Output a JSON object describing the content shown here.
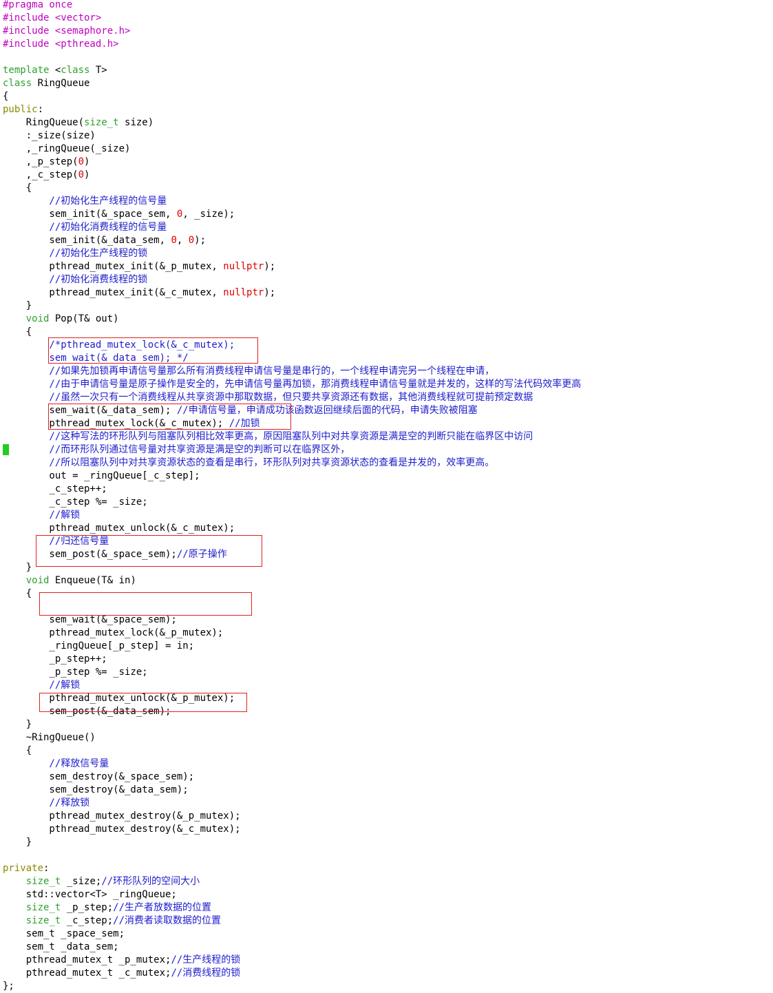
{
  "palette": {
    "default": "#000000",
    "preprocessor": "#c000c0",
    "keyword": "#8a8a00",
    "type": "#2ea02e",
    "number": "#dd0000",
    "comment": "#1c1ccc",
    "highlight_box": "#e0201c",
    "cursor": "#22cc22"
  },
  "lines": [
    [
      [
        "#pragma once",
        "preprocessor"
      ]
    ],
    [
      [
        "#include <vector>",
        "preprocessor"
      ]
    ],
    [
      [
        "#include <semaphore.h>",
        "preprocessor"
      ]
    ],
    [
      [
        "#include <pthread.h>",
        "preprocessor"
      ]
    ],
    [],
    [
      [
        "template",
        "type"
      ],
      [
        " <",
        ""
      ],
      [
        "class",
        "type"
      ],
      [
        " T>",
        ""
      ]
    ],
    [
      [
        "class",
        "type"
      ],
      [
        " RingQueue",
        ""
      ]
    ],
    [
      [
        "{",
        ""
      ]
    ],
    [
      [
        "public",
        "keyword"
      ],
      [
        ":",
        ""
      ]
    ],
    [
      [
        "    RingQueue(",
        ""
      ],
      [
        "size_t",
        "type"
      ],
      [
        " size)",
        ""
      ]
    ],
    [
      [
        "    :_size(size)",
        ""
      ]
    ],
    [
      [
        "    ,_ringQueue(_size)",
        ""
      ]
    ],
    [
      [
        "    ,_p_step(",
        ""
      ],
      [
        "0",
        "number"
      ],
      [
        ")",
        ""
      ]
    ],
    [
      [
        "    ,_c_step(",
        ""
      ],
      [
        "0",
        "number"
      ],
      [
        ")",
        ""
      ]
    ],
    [
      [
        "    {",
        ""
      ]
    ],
    [
      [
        "        //初始化生产线程的信号量",
        "comment"
      ]
    ],
    [
      [
        "        sem_init(&_space_sem, ",
        ""
      ],
      [
        "0",
        "number"
      ],
      [
        ", _size);",
        ""
      ]
    ],
    [
      [
        "        //初始化消费线程的信号量",
        "comment"
      ]
    ],
    [
      [
        "        sem_init(&_data_sem, ",
        ""
      ],
      [
        "0",
        "number"
      ],
      [
        ", ",
        ""
      ],
      [
        "0",
        "number"
      ],
      [
        ");",
        ""
      ]
    ],
    [
      [
        "        //初始化生产线程的锁",
        "comment"
      ]
    ],
    [
      [
        "        pthread_mutex_init(&_p_mutex, ",
        ""
      ],
      [
        "nullptr",
        "number"
      ],
      [
        ");",
        ""
      ]
    ],
    [
      [
        "        //初始化消费线程的锁",
        "comment"
      ]
    ],
    [
      [
        "        pthread_mutex_init(&_c_mutex, ",
        ""
      ],
      [
        "nullptr",
        "number"
      ],
      [
        ");",
        ""
      ]
    ],
    [
      [
        "    }",
        ""
      ]
    ],
    [
      [
        "    ",
        ""
      ],
      [
        "void",
        "type"
      ],
      [
        " Pop(T& out)",
        ""
      ]
    ],
    [
      [
        "    {",
        ""
      ]
    ],
    [
      [
        "        /*pthread_mutex_lock(&_c_mutex);",
        "comment"
      ]
    ],
    [
      [
        "        sem_wait(&_data_sem); */",
        "comment"
      ]
    ],
    [
      [
        "        //如果先加锁再申请信号量那么所有消费线程申请信号量是串行的，一个线程申请完另一个线程在申请，",
        "comment"
      ]
    ],
    [
      [
        "        //由于申请信号量是原子操作是安全的，先申请信号量再加锁，那消费线程申请信号量就是并发的，这样的写法代码效率更高",
        "comment"
      ]
    ],
    [
      [
        "        //虽然一次只有一个消费线程从共享资源中那取数据，但只要共享资源还有数据，其他消费线程就可提前预定数据",
        "comment"
      ]
    ],
    [
      [
        "        sem_wait(&_data_sem); ",
        ""
      ],
      [
        "//申请信号量，申请成功该函数返回继续后面的代码，申请失败被阻塞",
        "comment"
      ]
    ],
    [
      [
        "        pthread_mutex_lock(&_c_mutex); ",
        ""
      ],
      [
        "//加锁",
        "comment"
      ]
    ],
    [
      [
        "        //这种写法的环形队列与阻塞队列相比效率更高，原因阻塞队列中对共享资源是满是空的判断只能在临界区中访问",
        "comment"
      ]
    ],
    [
      [
        "        //而环形队列通过信号量对共享资源是满是空的判断可以在临界区外，",
        "comment"
      ]
    ],
    [
      [
        "        //所以阻塞队列中对共享资源状态的查看是串行，环形队列对共享资源状态的查看是并发的，效率更高。",
        "comment"
      ]
    ],
    [
      [
        "        out = _ringQueue[_c_step];",
        ""
      ]
    ],
    [
      [
        "        _c_step++;",
        ""
      ]
    ],
    [
      [
        "        _c_step %= _size;",
        ""
      ]
    ],
    [
      [
        "        //解锁",
        "comment"
      ]
    ],
    [
      [
        "        pthread_mutex_unlock(&_c_mutex);",
        ""
      ]
    ],
    [
      [
        "        //归还信号量",
        "comment"
      ]
    ],
    [
      [
        "        sem_post(&_space_sem);",
        ""
      ],
      [
        "//原子操作",
        "comment"
      ]
    ],
    [
      [
        "    }",
        ""
      ]
    ],
    [
      [
        "    ",
        ""
      ],
      [
        "void",
        "type"
      ],
      [
        " Enqueue(T& in)",
        ""
      ]
    ],
    [
      [
        "    {",
        ""
      ]
    ],
    [],
    [
      [
        "        sem_wait(&_space_sem);",
        ""
      ]
    ],
    [
      [
        "        pthread_mutex_lock(&_p_mutex);",
        ""
      ]
    ],
    [
      [
        "        _ringQueue[_p_step] = in;",
        ""
      ]
    ],
    [
      [
        "        _p_step++;",
        ""
      ]
    ],
    [
      [
        "        _p_step %= _size;",
        ""
      ]
    ],
    [
      [
        "        //解锁",
        "comment"
      ]
    ],
    [
      [
        "        pthread_mutex_unlock(&_p_mutex);",
        ""
      ]
    ],
    [
      [
        "        sem_post(&_data_sem);",
        ""
      ]
    ],
    [
      [
        "    }",
        ""
      ]
    ],
    [
      [
        "    ~RingQueue()",
        ""
      ]
    ],
    [
      [
        "    {",
        ""
      ]
    ],
    [
      [
        "        //释放信号量",
        "comment"
      ]
    ],
    [
      [
        "        sem_destroy(&_space_sem);",
        ""
      ]
    ],
    [
      [
        "        sem_destroy(&_data_sem);",
        ""
      ]
    ],
    [
      [
        "        //释放锁",
        "comment"
      ]
    ],
    [
      [
        "        pthread_mutex_destroy(&_p_mutex);",
        ""
      ]
    ],
    [
      [
        "        pthread_mutex_destroy(&_c_mutex);",
        ""
      ]
    ],
    [
      [
        "    }",
        ""
      ]
    ],
    [],
    [
      [
        "private",
        "keyword"
      ],
      [
        ":",
        ""
      ]
    ],
    [
      [
        "    ",
        ""
      ],
      [
        "size_t",
        "type"
      ],
      [
        " _size;",
        ""
      ],
      [
        "//环形队列的空间大小",
        "comment"
      ]
    ],
    [
      [
        "    std::vector<T> _ringQueue;",
        ""
      ]
    ],
    [
      [
        "    ",
        ""
      ],
      [
        "size_t",
        "type"
      ],
      [
        " _p_step;",
        ""
      ],
      [
        "//生产者放数据的位置",
        "comment"
      ]
    ],
    [
      [
        "    ",
        ""
      ],
      [
        "size_t",
        "type"
      ],
      [
        " _c_step;",
        ""
      ],
      [
        "//消费者读取数据的位置",
        "comment"
      ]
    ],
    [
      [
        "    sem_t _space_sem;",
        ""
      ]
    ],
    [
      [
        "    sem_t _data_sem;",
        ""
      ]
    ],
    [
      [
        "    pthread_mutex_t _p_mutex;",
        ""
      ],
      [
        "//生产线程的锁",
        "comment"
      ]
    ],
    [
      [
        "    pthread_mutex_t _c_mutex;",
        ""
      ],
      [
        "//消费线程的锁",
        "comment"
      ]
    ],
    [
      [
        "};",
        ""
      ]
    ]
  ]
}
